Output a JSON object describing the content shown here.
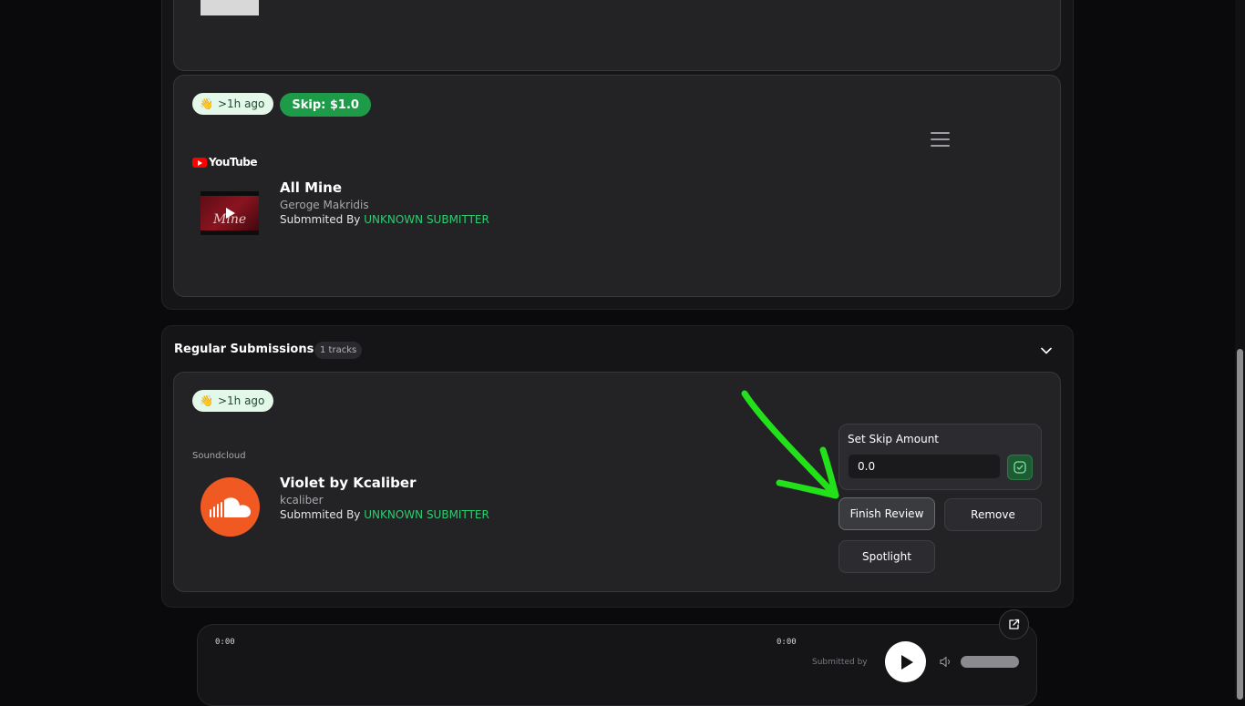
{
  "previous_card": {
    "thumbnail_icon": "vinyl-record"
  },
  "youtube_card": {
    "time_pill": {
      "emoji": "👋",
      "text": ">1h ago"
    },
    "skip_pill": "Skip: $1.0",
    "platform_logo_text": "YouTube",
    "thumbnail_text": "Mine",
    "title": "All Mine",
    "artist": "Geroge Makridis",
    "submitted_prefix": "Submmited By",
    "submitter": "UNKNOWN SUBMITTER",
    "menu_icon": "hamburger-menu"
  },
  "regular_section": {
    "title": "Regular Submissions",
    "count": "1 tracks",
    "chevron_icon": "chevron-down"
  },
  "soundcloud_card": {
    "time_pill": {
      "emoji": "👋",
      "text": ">1h ago"
    },
    "platform_label": "Soundcloud",
    "title": "Violet by Kcaliber",
    "artist": "kcaliber",
    "submitted_prefix": "Submmited By",
    "submitter": "UNKNOWN SUBMITTER",
    "skip_panel": {
      "label": "Set Skip Amount",
      "value": "0.0"
    },
    "buttons": {
      "finish": "Finish Review",
      "remove": "Remove",
      "spotlight": "Spotlight"
    }
  },
  "player": {
    "elapsed": "0:00",
    "duration": "0:00",
    "submitted_by": "Submitted by"
  },
  "colors": {
    "accent_green": "#2ecc71",
    "skip_green": "#1e9b49",
    "annotation_arrow": "#22e01a",
    "soundcloud_orange": "#f05a22",
    "youtube_red": "#ff0000"
  }
}
